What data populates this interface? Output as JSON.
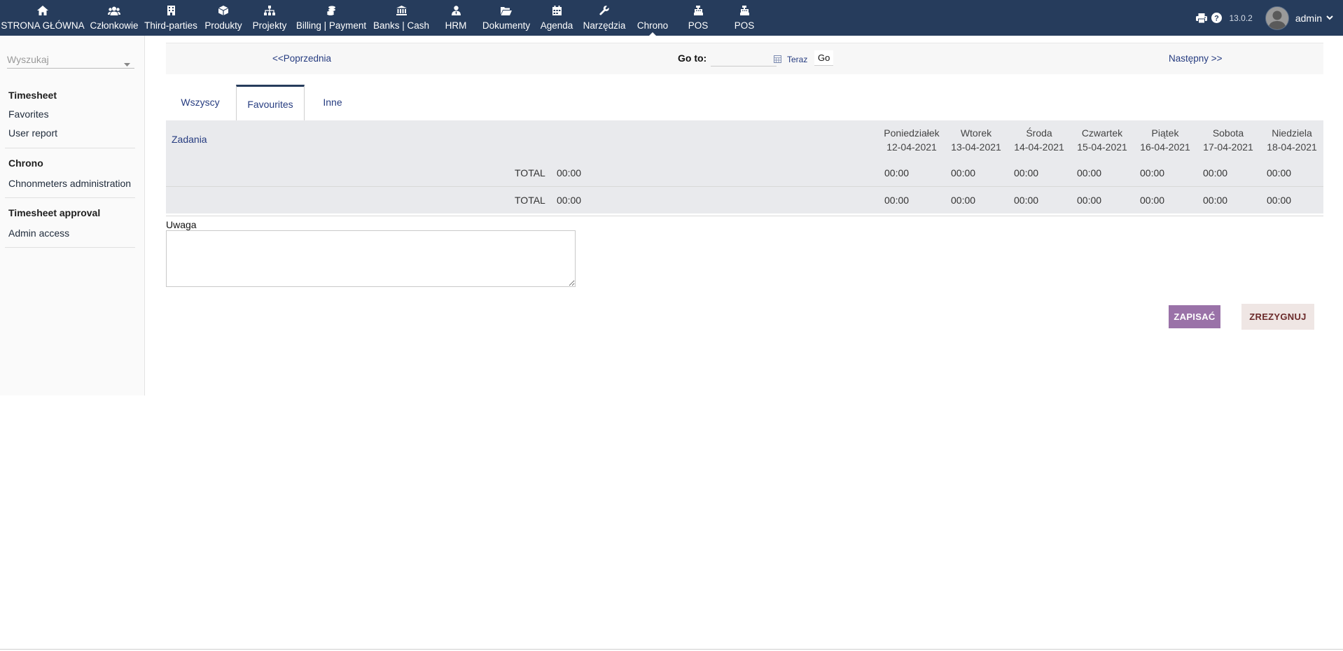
{
  "topnav": {
    "items": [
      {
        "label": "STRONA GŁÓWNA",
        "icon": "home-icon"
      },
      {
        "label": "Członkowie",
        "icon": "users-icon"
      },
      {
        "label": "Third-parties",
        "icon": "building-icon"
      },
      {
        "label": "Produkty",
        "icon": "cube-icon"
      },
      {
        "label": "Projekty",
        "icon": "sitemap-icon"
      },
      {
        "label": "Billing | Payment",
        "icon": "coins-icon"
      },
      {
        "label": "Banks | Cash",
        "icon": "bank-icon"
      },
      {
        "label": "HRM",
        "icon": "user-tie-icon"
      },
      {
        "label": "Dokumenty",
        "icon": "folder-open-icon"
      },
      {
        "label": "Agenda",
        "icon": "calendar-icon"
      },
      {
        "label": "Narzędzia",
        "icon": "wrench-icon"
      },
      {
        "label": "Chrono",
        "icon": "none",
        "active": true
      },
      {
        "label": "POS",
        "icon": "cash-register-icon"
      },
      {
        "label": "POS",
        "icon": "cash-register-icon"
      }
    ],
    "version": "13.0.2",
    "user": "admin",
    "bg_color": "#263c5c"
  },
  "sidebar": {
    "search_placeholder": "Wyszukaj",
    "sections": [
      {
        "title": "Timesheet",
        "links": [
          "Favorites",
          "User report"
        ]
      },
      {
        "title": "Chrono",
        "links": [
          "Chnonmeters administration"
        ]
      },
      {
        "title": "Timesheet approval",
        "links": [
          "Admin access"
        ]
      }
    ]
  },
  "navbar": {
    "prev": "<<Poprzednia",
    "goto_label": "Go to:",
    "goto_value": "",
    "now": "Teraz",
    "go": "Go",
    "next": "Następny >>"
  },
  "tabs": [
    {
      "label": "Wszyscy",
      "active": false
    },
    {
      "label": "Favourites",
      "active": true
    },
    {
      "label": "Inne",
      "active": false
    }
  ],
  "table": {
    "tasks_header": "Zadania",
    "days": [
      {
        "name": "Poniedziałek",
        "date": "12-04-2021"
      },
      {
        "name": "Wtorek",
        "date": "13-04-2021"
      },
      {
        "name": "Środa",
        "date": "14-04-2021"
      },
      {
        "name": "Czwartek",
        "date": "15-04-2021"
      },
      {
        "name": "Piątek",
        "date": "16-04-2021"
      },
      {
        "name": "Sobota",
        "date": "17-04-2021"
      },
      {
        "name": "Niedziela",
        "date": "18-04-2021"
      }
    ],
    "rows": [
      {
        "label": "TOTAL",
        "total": "00:00",
        "days": [
          "00:00",
          "00:00",
          "00:00",
          "00:00",
          "00:00",
          "00:00",
          "00:00"
        ]
      },
      {
        "label": "TOTAL",
        "total": "00:00",
        "days": [
          "00:00",
          "00:00",
          "00:00",
          "00:00",
          "00:00",
          "00:00",
          "00:00"
        ]
      }
    ]
  },
  "note": {
    "label": "Uwaga",
    "value": ""
  },
  "actions": {
    "save": "ZAPISAĆ",
    "cancel": "ZREZYGNUJ",
    "save_color": "#9a72a8",
    "cancel_color": "#efe6e4"
  }
}
